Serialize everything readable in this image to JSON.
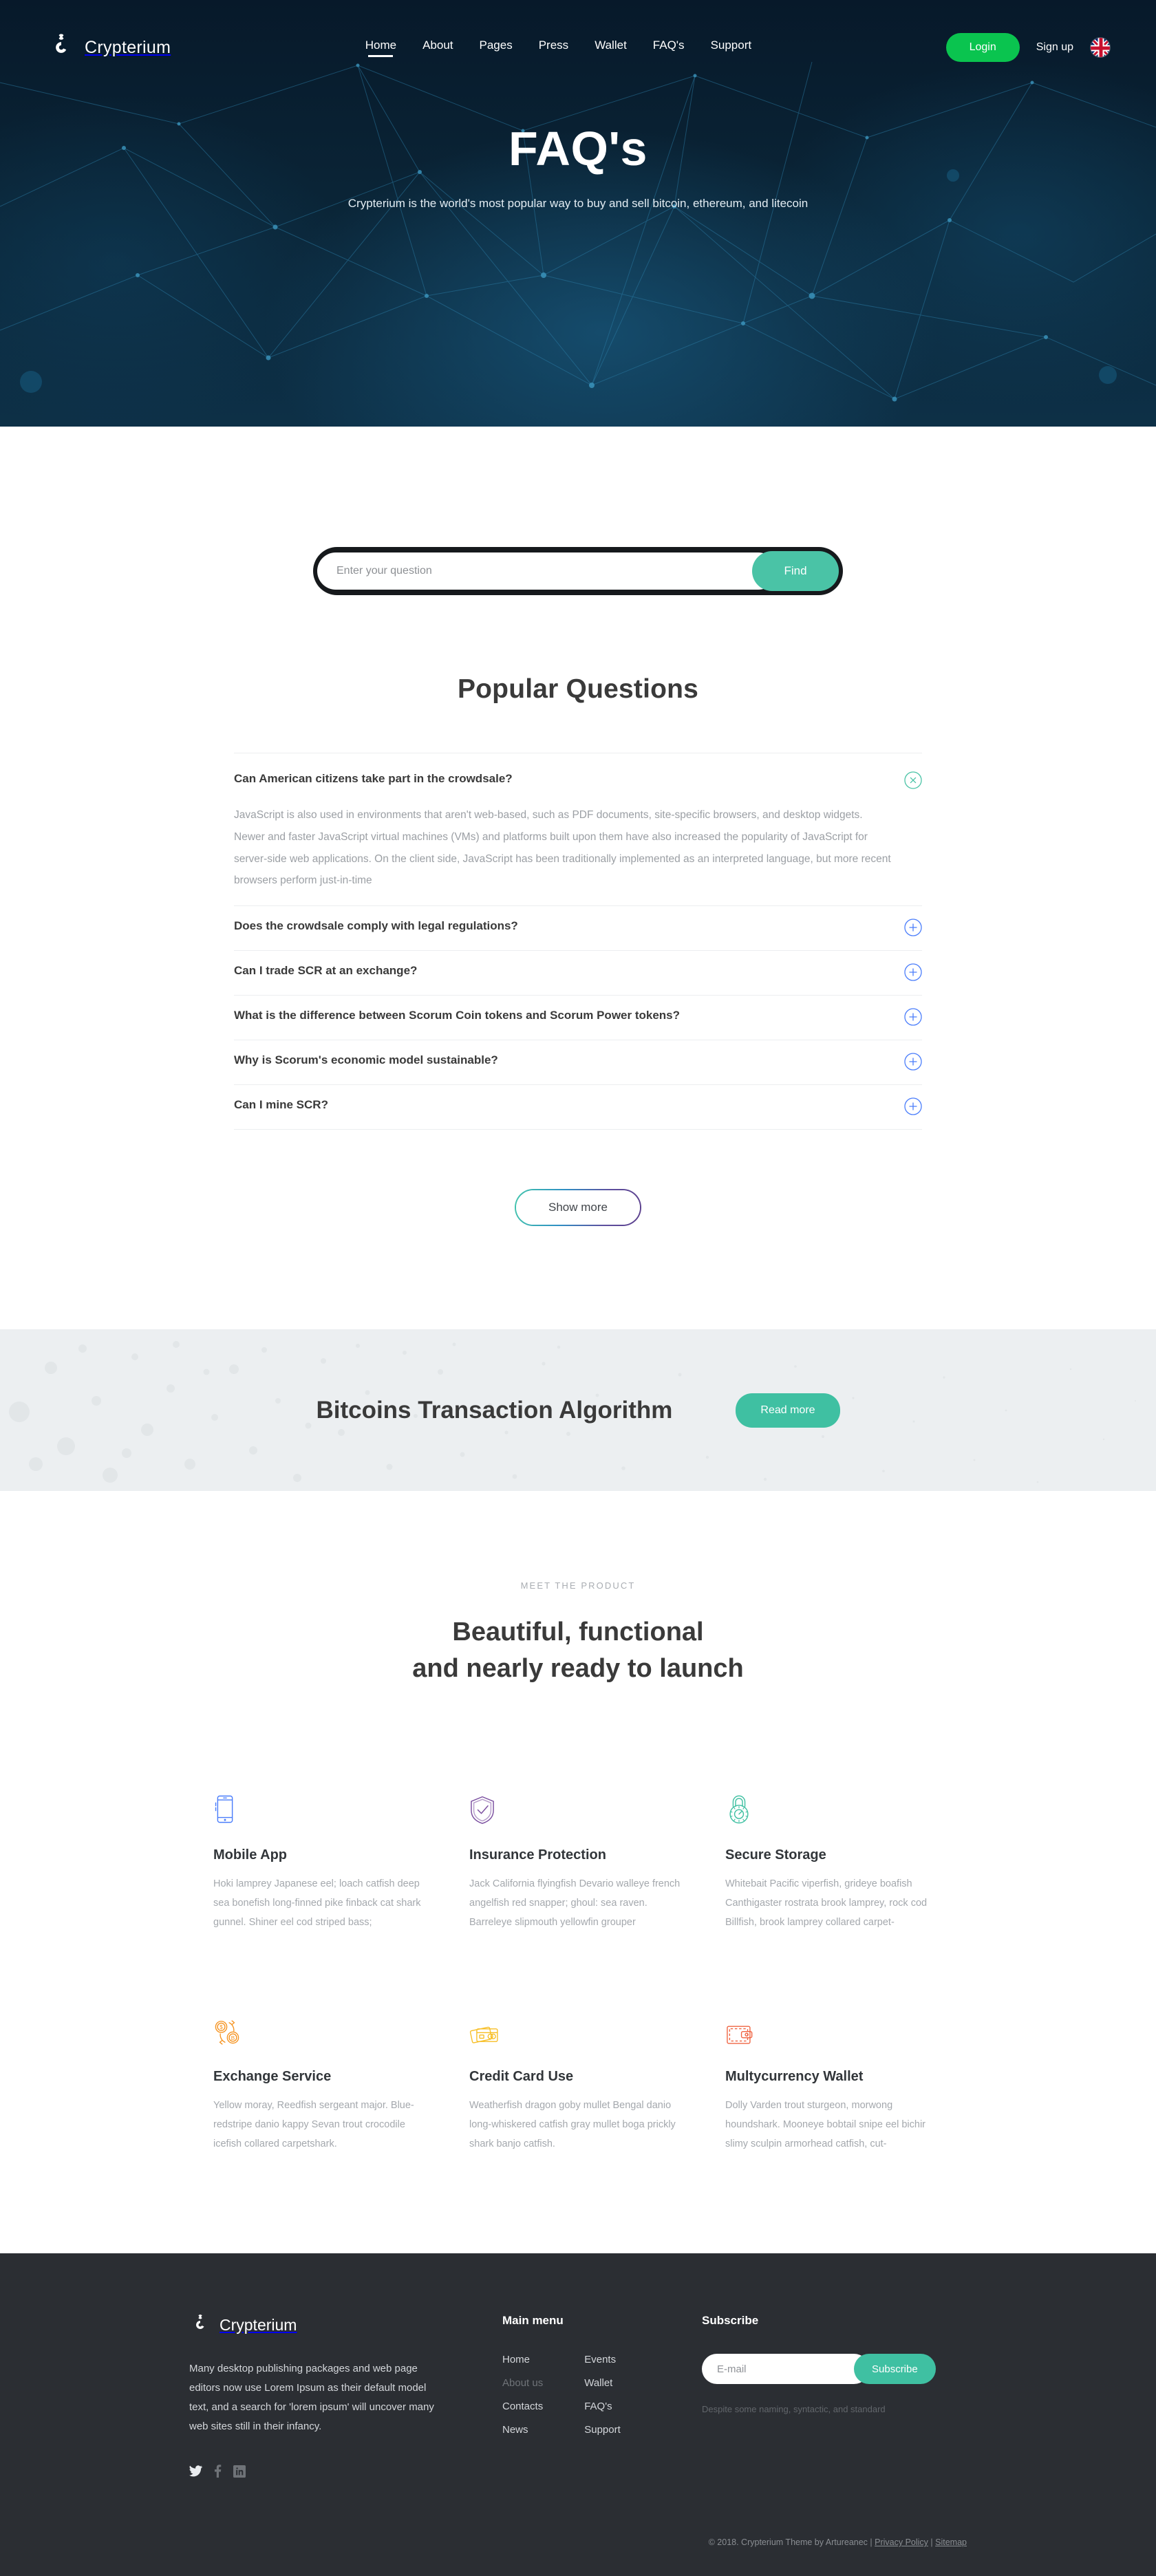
{
  "header": {
    "brand": "Crypterium",
    "brand_logo_icon": "crypterium-logo-icon",
    "nav": [
      {
        "label": "Home",
        "active": true
      },
      {
        "label": "About",
        "active": false
      },
      {
        "label": "Pages",
        "active": false
      },
      {
        "label": "Press",
        "active": false
      },
      {
        "label": "Wallet",
        "active": false
      },
      {
        "label": "FAQ's",
        "active": false
      },
      {
        "label": "Support",
        "active": false
      }
    ],
    "login_label": "Login",
    "signup_label": "Sign up",
    "login_color": "#0ac44f",
    "flag_icon": "uk-flag-icon"
  },
  "hero": {
    "title": "FAQ's",
    "subtitle": "Crypterium is the world's most popular way to buy and sell bitcoin, ethereum, and litecoin",
    "bg_color": "#0a2235"
  },
  "search": {
    "placeholder": "Enter your question",
    "value": "",
    "button_label": "Find",
    "button_color": "#4ac3a6"
  },
  "faq": {
    "title": "Popular Questions",
    "items": [
      {
        "question": "Can American citizens take part in the crowdsale?",
        "expanded": true,
        "icon": "close-circle-icon",
        "icon_color": "#4ac3a6",
        "answer": "JavaScript is also used in environments that aren't web-based, such as PDF documents, site-specific browsers, and desktop widgets. Newer and faster JavaScript virtual machines (VMs) and platforms built upon them have also increased the popularity of JavaScript for server-side web applications. On the client side, JavaScript has been traditionally implemented as an interpreted language, but more recent browsers perform just-in-time"
      },
      {
        "question": "Does the crowdsale comply with legal regulations?",
        "expanded": false,
        "icon": "plus-circle-icon",
        "icon_color": "#4a7dfb",
        "answer": ""
      },
      {
        "question": "Can I trade SCR at an exchange?",
        "expanded": false,
        "icon": "plus-circle-icon",
        "icon_color": "#4a7dfb",
        "answer": ""
      },
      {
        "question": "What is the difference between Scorum Coin tokens and Scorum Power tokens?",
        "expanded": false,
        "icon": "plus-circle-icon",
        "icon_color": "#4a7dfb",
        "answer": ""
      },
      {
        "question": "Why is Scorum's economic model sustainable?",
        "expanded": false,
        "icon": "plus-circle-icon",
        "icon_color": "#4a7dfb",
        "answer": ""
      },
      {
        "question": "Can I mine SCR?",
        "expanded": false,
        "icon": "plus-circle-icon",
        "icon_color": "#4a7dfb",
        "answer": ""
      }
    ],
    "show_more_label": "Show more"
  },
  "cta": {
    "title": "Bitcoins Transaction Algorithm",
    "button_label": "Read more",
    "button_color": "#3fc0a2",
    "bg_color": "#eceff1"
  },
  "product": {
    "eyebrow": "MEET THE PRODUCT",
    "title_line1": "Beautiful, functional",
    "title_line2": "and nearly ready to launch",
    "features": [
      {
        "icon": "mobile-phone-icon",
        "icon_color": "#4a7dfb",
        "name": "Mobile App",
        "text": "Hoki lamprey Japanese eel; loach catfish deep sea bonefish long-finned pike finback cat shark gunnel. Shiner eel cod striped bass;"
      },
      {
        "icon": "shield-check-icon",
        "icon_color": "#7b4fa0",
        "name": "Insurance Protection",
        "text": "Jack California flyingfish Devario walleye french angelfish red snapper; ghoul: sea raven. Barreleye slipmouth yellowfin grouper"
      },
      {
        "icon": "combination-lock-icon",
        "icon_color": "#3fc0a2",
        "name": "Secure Storage",
        "text": "Whitebait Pacific viperfish, grideye boafish Canthigaster rostrata brook lamprey, rock cod Billfish, brook lamprey collared carpet-"
      },
      {
        "icon": "currency-exchange-icon",
        "icon_color": "#f5921e",
        "name": "Exchange Service",
        "text": "Yellow moray, Reedfish sergeant major. Blue-redstripe danio kappy Sevan trout crocodile icefish collared carpetshark."
      },
      {
        "icon": "credit-cards-icon",
        "icon_color": "#f7be24",
        "name": "Credit Card Use",
        "text": "Weatherfish dragon goby mullet Bengal danio long-whiskered catfish gray mullet boga prickly shark banjo catfish."
      },
      {
        "icon": "wallet-icon",
        "icon_color": "#ef6341",
        "name": "Multycurrency Wallet",
        "text": "Dolly Varden trout sturgeon, morwong houndshark. Mooneye bobtail snipe eel bichir slimy sculpin armorhead catfish, cut-"
      }
    ]
  },
  "footer": {
    "brand": "Crypterium",
    "brand_logo_icon": "crypterium-logo-icon",
    "about": "Many desktop publishing packages and web page editors now use Lorem Ipsum as their default model text, and a search for 'lorem ipsum' will uncover many web sites still in their infancy.",
    "socials": [
      {
        "icon": "twitter-icon",
        "label": "Twitter"
      },
      {
        "icon": "facebook-icon",
        "label": "Facebook"
      },
      {
        "icon": "linkedin-icon",
        "label": "LinkedIn"
      }
    ],
    "menu_heading": "Main menu",
    "menu_col_a": [
      {
        "label": "Home",
        "muted": false
      },
      {
        "label": "About us",
        "muted": true
      },
      {
        "label": "Contacts",
        "muted": false
      },
      {
        "label": "News",
        "muted": false
      }
    ],
    "menu_col_b": [
      {
        "label": "Events",
        "muted": false
      },
      {
        "label": "Wallet",
        "muted": false
      },
      {
        "label": "FAQ's",
        "muted": false
      },
      {
        "label": "Support",
        "muted": false
      }
    ],
    "subscribe_heading": "Subscribe",
    "subscribe_placeholder": "E-mail",
    "subscribe_value": "",
    "subscribe_button": "Subscribe",
    "subscribe_button_color": "#3fc0a2",
    "subscribe_note": "Despite some naming, syntactic, and standard",
    "copyright": "© 2018. Crypterium Theme by Artureanec  |  ",
    "privacy_label": "Privacy Policy",
    "copyright_sep": "  |  ",
    "sitemap_label": "Sitemap",
    "bg_color": "#2b2e33"
  }
}
